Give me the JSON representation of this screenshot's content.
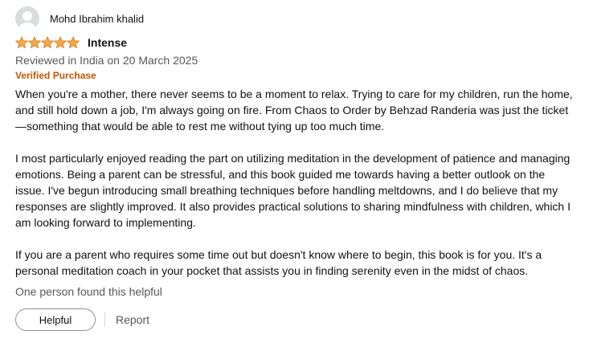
{
  "reviewer": {
    "name": "Mohd Ibrahim khalid",
    "avatar_icon": "user-avatar-icon"
  },
  "rating": {
    "stars": 5,
    "max": 5,
    "icon": "star-icon",
    "color": "#f3a847"
  },
  "review": {
    "title": "Intense",
    "date": "Reviewed in India on 20 March 2025",
    "badge": "Verified Purchase",
    "paragraphs": [
      "When you're a mother, there never seems to be a moment to relax. Trying to care for my children, run the home, and still hold down a job, I'm always going on fire. From Chaos to Order by Behzad Randeria was just the ticket—something that would be able to rest me without tying up too much time.",
      "I most particularly enjoyed reading the part on utilizing meditation in the development of patience and managing emotions. Being a parent can be stressful, and this book guided me towards having a better outlook on the issue. I've begun introducing small breathing techniques before handling meltdowns, and I do believe that my responses are slightly improved. It also provides practical solutions to sharing mindfulness with children, which I am looking forward to implementing.",
      "If you are a parent who requires some time out but doesn't know where to begin, this book is for you. It's a personal meditation coach in your pocket that assists you in finding serenity even in the midst of chaos."
    ]
  },
  "helpful_text": "One person found this helpful",
  "actions": {
    "helpful_label": "Helpful",
    "report_label": "Report"
  },
  "colors": {
    "verified": "#c45500",
    "secondary_text": "#565959"
  }
}
